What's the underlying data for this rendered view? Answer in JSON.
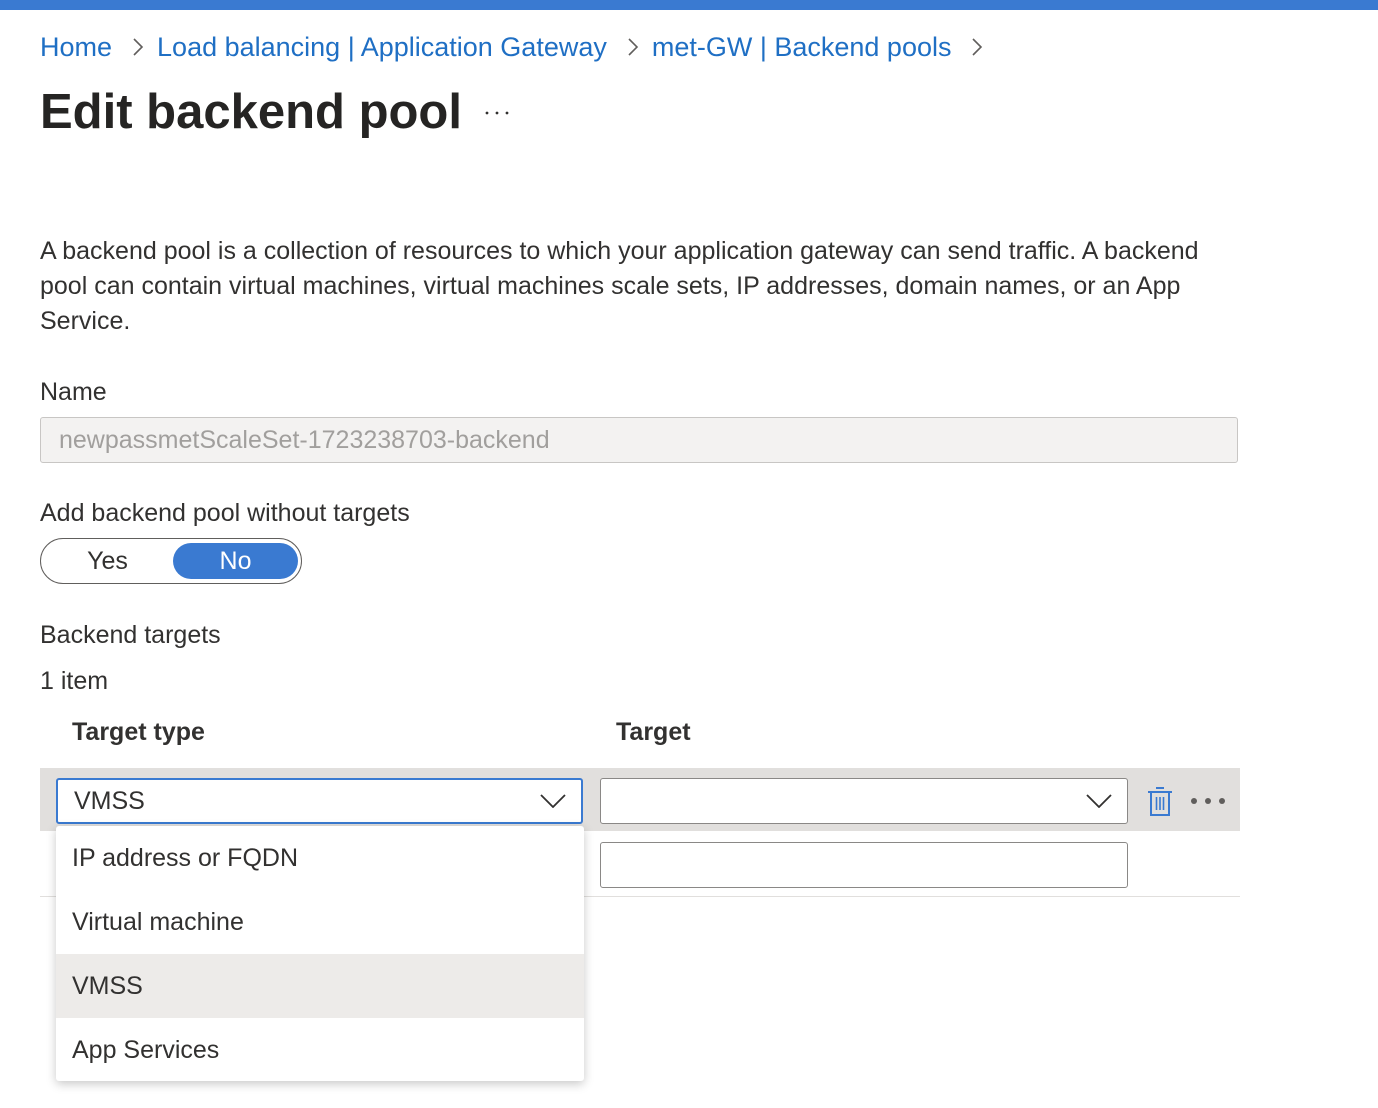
{
  "breadcrumb": [
    "Home",
    "Load balancing | Application Gateway",
    "met-GW | Backend pools"
  ],
  "title": "Edit backend pool",
  "title_more": "···",
  "description": "A backend pool is a collection of resources to which your application gateway can send traffic. A backend pool can contain virtual machines, virtual machines scale sets, IP addresses, domain names, or an App Service.",
  "name_field": {
    "label": "Name",
    "value": "newpassmetScaleSet-1723238703-backend"
  },
  "without_targets": {
    "label": "Add backend pool without targets",
    "yes": "Yes",
    "no": "No",
    "selected": "No"
  },
  "backend_targets": {
    "heading": "Backend targets",
    "count": "1 item",
    "columns": [
      "Target type",
      "Target"
    ],
    "row": {
      "target_type": "VMSS",
      "target": ""
    },
    "dropdown_options": [
      "IP address or FQDN",
      "Virtual machine",
      "VMSS",
      "App Services"
    ],
    "dropdown_selected": "VMSS"
  },
  "colors": {
    "accent": "#3a7ad1",
    "link": "#1f6fc4",
    "row_highlight": "#e1dfdd"
  },
  "icons": [
    "chevron-right-icon",
    "ellipsis-icon",
    "chevron-down-icon",
    "trash-icon"
  ]
}
